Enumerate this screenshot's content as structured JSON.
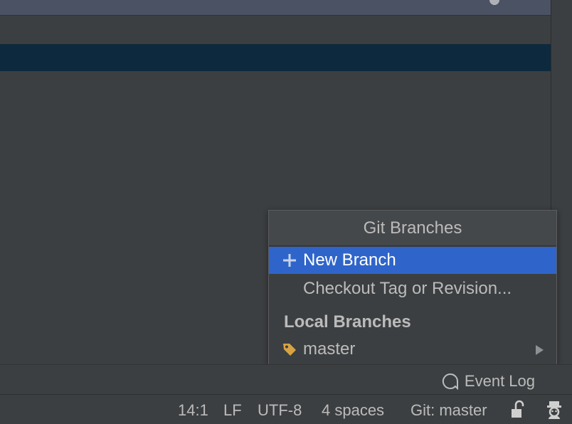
{
  "popup": {
    "title": "Git Branches",
    "actions": [
      {
        "label": "New Branch",
        "icon": "plus-icon",
        "selected": true
      },
      {
        "label": "Checkout Tag or Revision...",
        "icon": "",
        "selected": false
      }
    ],
    "local_branches_header": "Local Branches",
    "local_branches": [
      {
        "label": "master",
        "icon": "tag-icon",
        "has_submenu": true
      }
    ]
  },
  "toolwindows": {
    "event_log_label": "Event Log"
  },
  "status_bar": {
    "position": "14:1",
    "line_separator": "LF",
    "encoding": "UTF-8",
    "indent": "4 spaces",
    "vcs_branch": "Git: master",
    "lock_icon": "unlocked-icon",
    "inspector_icon": "hector-icon"
  },
  "colors": {
    "background": "#3c3f41",
    "selection_row": "#0d293e",
    "popup_selected": "#2f65ca",
    "tag_icon": "#d8a243",
    "text": "#bbbbbb"
  }
}
